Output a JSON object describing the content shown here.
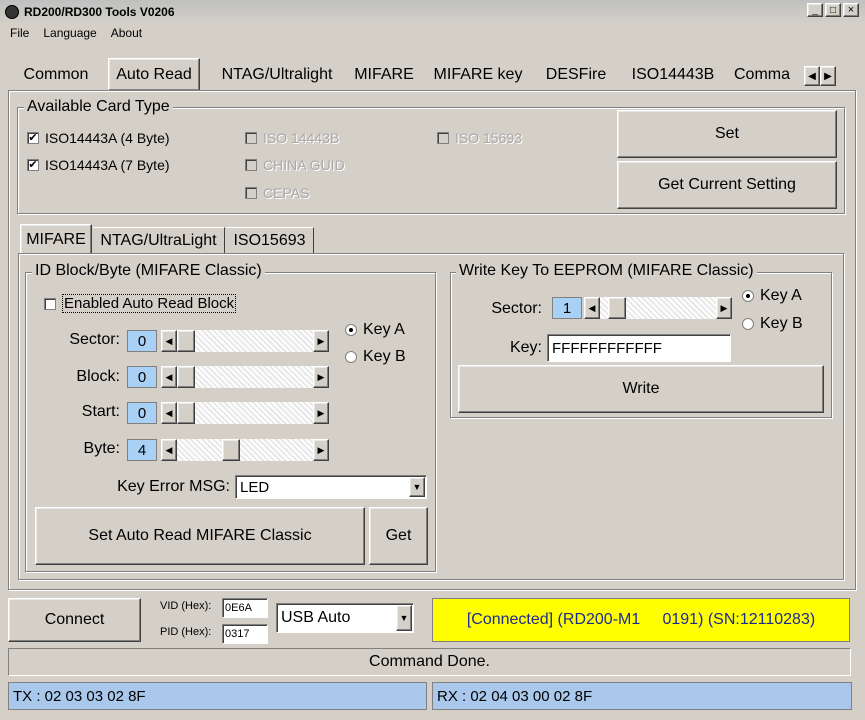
{
  "window": {
    "title": "RD200/RD300 Tools V0206",
    "controls": [
      "_",
      "□",
      "×"
    ]
  },
  "menu": [
    "File",
    "Language",
    "About"
  ],
  "main_tabs": [
    "Common",
    "Auto Read",
    "NTAG/Ultralight",
    "MIFARE",
    "MIFARE key",
    "DESFire",
    "ISO14443B",
    "Comma"
  ],
  "card_type": {
    "legend": "Available Card Type",
    "items": [
      {
        "label": "ISO14443A (4 Byte)",
        "checked": true,
        "enabled": true
      },
      {
        "label": "ISO14443A (7 Byte)",
        "checked": true,
        "enabled": true
      },
      {
        "label": "ISO 14443B",
        "checked": false,
        "enabled": false
      },
      {
        "label": "CHINA GUID",
        "checked": false,
        "enabled": false
      },
      {
        "label": "CEPAS",
        "checked": false,
        "enabled": false
      },
      {
        "label": "ISO 15693",
        "checked": false,
        "enabled": false
      }
    ],
    "set_label": "Set",
    "get_setting_label": "Get Current Setting"
  },
  "sub_tabs": [
    "MIFARE",
    "NTAG/UltraLight",
    "ISO15693"
  ],
  "id_block": {
    "legend": "ID Block/Byte (MIFARE Classic)",
    "enabled_label": "Enabled Auto Read Block",
    "sector_label": "Sector:",
    "sector_value": "0",
    "block_label": "Block:",
    "block_value": "0",
    "start_label": "Start:",
    "start_value": "0",
    "byte_label": "Byte:",
    "byte_value": "4",
    "key_a": "Key A",
    "key_b": "Key B",
    "key_error_label": "Key Error MSG:",
    "key_error_value": "LED",
    "set_button": "Set Auto Read MIFARE Classic",
    "get_button": "Get"
  },
  "write_key": {
    "legend": "Write Key To EEPROM (MIFARE Classic)",
    "sector_label": "Sector:",
    "sector_value": "1",
    "key_a": "Key A",
    "key_b": "Key B",
    "key_label": "Key:",
    "key_value": "FFFFFFFFFFFF",
    "write_button": "Write"
  },
  "connection": {
    "connect_label": "Connect",
    "vid_label": "VID (Hex):",
    "vid_value": "0E6A",
    "pid_label": "PID (Hex):",
    "pid_value": "0317",
    "mode_value": "USB Auto",
    "status": "[Connected] (RD200-M1     0191) (SN:12110283)"
  },
  "status_message": "Command Done.",
  "tx": "TX : 02 03 03 02 8F",
  "rx": "RX : 02 04 03 00 02 8F",
  "colors": {
    "status_bg": "#ffff00",
    "status_text": "#1c2a8c",
    "txrx_bg": "#a9c8ec",
    "spin_bg": "#a9d0f5"
  }
}
